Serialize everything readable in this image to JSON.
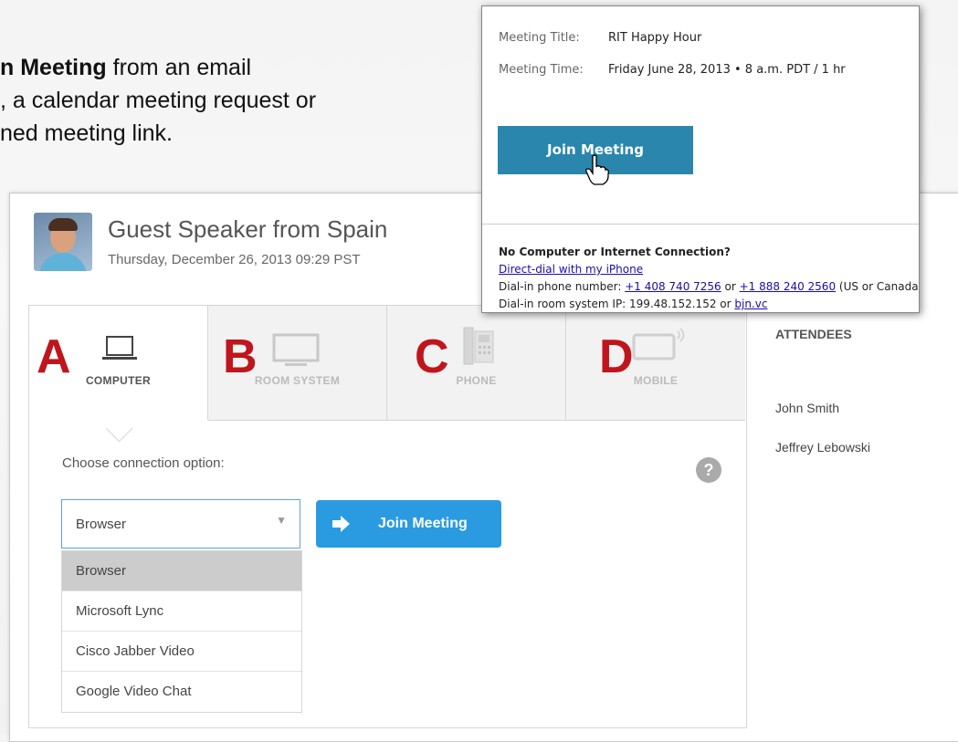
{
  "instruction": {
    "bold": "n Meeting",
    "line1_rest": " from an email",
    "line2": ", a calendar meeting request or",
    "line3": "ned meeting link."
  },
  "meeting": {
    "title": "Guest Speaker from Spain",
    "date": "Thursday, December 26, 2013 09:29 PST"
  },
  "tabs": [
    {
      "letter": "A",
      "label": "COMPUTER",
      "icon": "laptop-icon",
      "active": true
    },
    {
      "letter": "B",
      "label": "ROOM SYSTEM",
      "icon": "monitor-icon",
      "active": false
    },
    {
      "letter": "C",
      "label": "PHONE",
      "icon": "desk-phone-icon",
      "active": false
    },
    {
      "letter": "D",
      "label": "MOBILE",
      "icon": "mobile-icon",
      "active": false
    }
  ],
  "connection": {
    "label": "Choose connection option:",
    "help": "?",
    "selected": "Browser",
    "options": [
      "Browser",
      "Microsoft Lync",
      "Cisco Jabber Video",
      "Google Video Chat"
    ],
    "join_label": "Join Meeting"
  },
  "attendees": {
    "heading": "ATTENDEES",
    "names": [
      "John Smith",
      "Jeffrey Lebowski"
    ]
  },
  "popup": {
    "title_key": "Meeting Title:",
    "title_value": "RIT Happy Hour",
    "time_key": "Meeting Time:",
    "time_value": "Friday June 28, 2013 • 8 a.m. PDT / 1 hr",
    "join_label": "Join Meeting",
    "no_connection": "No Computer or Internet Connection?",
    "direct_dial": "Direct-dial with my iPhone",
    "dialin_prefix": "Dial-in phone number: ",
    "phone1": "+1 408 740 7256",
    "or1": " or ",
    "phone2": "+1 888 240 2560",
    "dialin_suffix": " (US or Canada)",
    "room_prefix": "Dial-in room system IP: 199.48.152.152 or ",
    "room_link": "bjn.vc"
  },
  "colors": {
    "accent_blue": "#2a9be0",
    "popup_button": "#2a86ac",
    "annotation_red": "#c0151c"
  }
}
